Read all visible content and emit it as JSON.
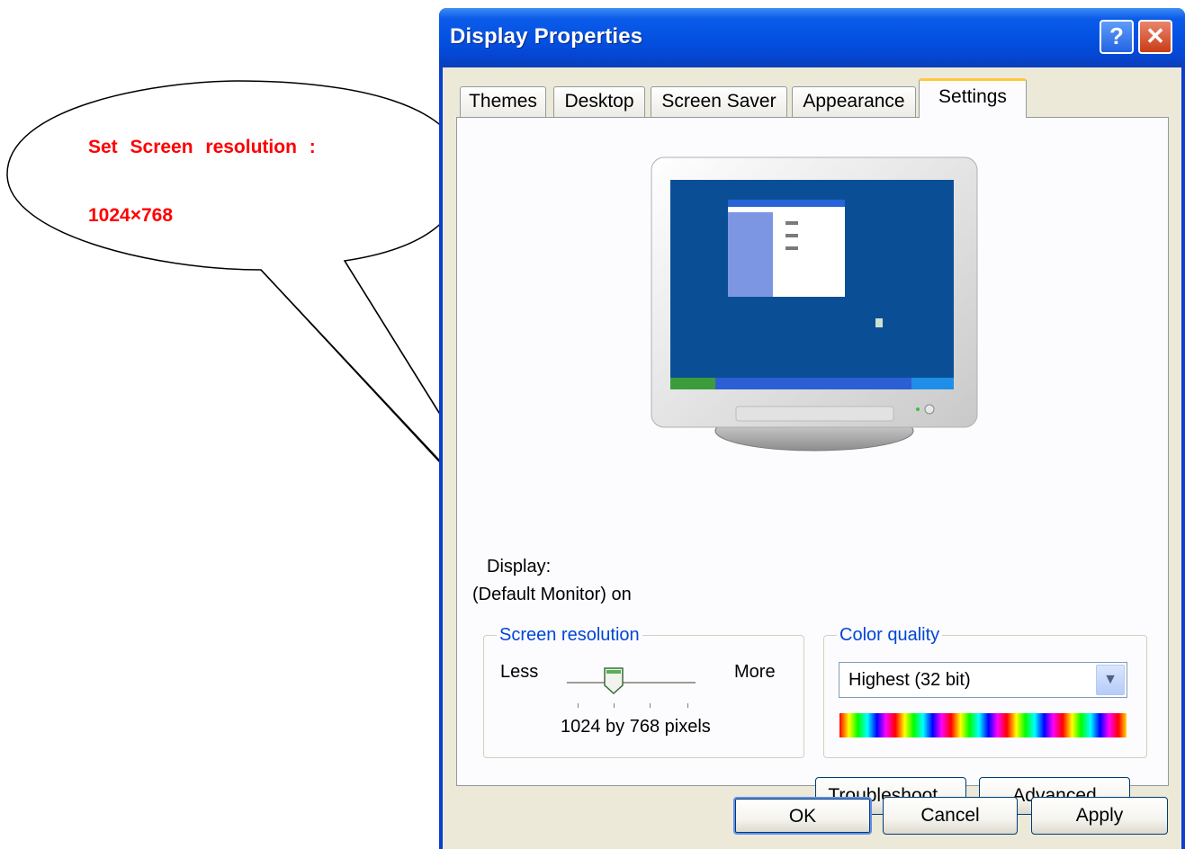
{
  "annotation": {
    "line1": "Set Screen resolution :",
    "line2": "1024×768",
    "color": "#ff0000"
  },
  "window": {
    "title": "Display Properties",
    "help_label": "?",
    "close_label": "✕",
    "tabs": [
      {
        "label": "Themes"
      },
      {
        "label": "Desktop"
      },
      {
        "label": "Screen Saver"
      },
      {
        "label": "Appearance"
      },
      {
        "label": "Settings",
        "selected": true
      }
    ],
    "display_label": "Display:",
    "display_value": "(Default Monitor) on",
    "screen_resolution": {
      "legend": "Screen resolution",
      "less_label": "Less",
      "more_label": "More",
      "value_text": "1024 by 768 pixels",
      "slider_position": 1,
      "slider_positions": 4
    },
    "color_quality": {
      "legend": "Color quality",
      "selected": "Highest (32 bit)"
    },
    "buttons": {
      "troubleshoot": "Troubleshoot...",
      "advanced": "Advanced",
      "ok": "OK",
      "cancel": "Cancel",
      "apply": "Apply"
    },
    "colors": {
      "titlebar": "#0350e0",
      "client": "#ece9d8",
      "group_legend": "#0046d5",
      "desktop_preview": "#0a4f96"
    }
  }
}
